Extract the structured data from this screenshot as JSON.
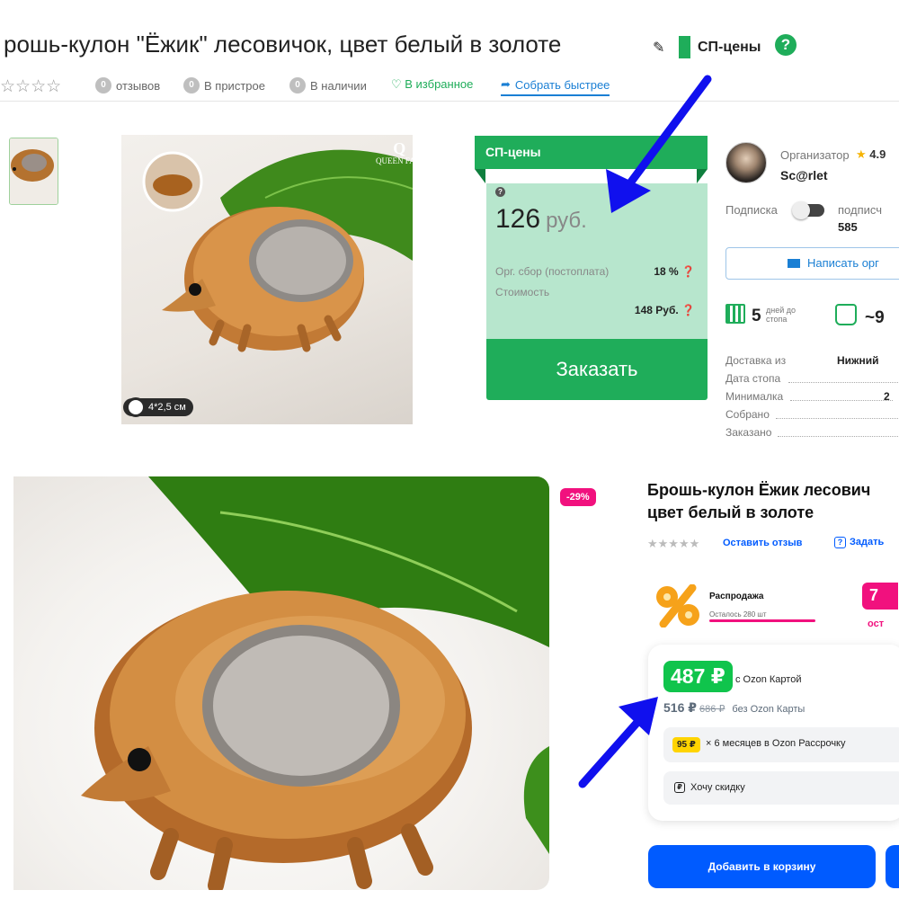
{
  "top": {
    "title": "рошь-кулон \"Ёжик\" лесовичок, цвет белый в золоте",
    "sp_label": "СП-цены",
    "stars": "☆☆☆☆",
    "meta": {
      "reviews_count": "0",
      "reviews_label": "отзывов",
      "fitting_count": "0",
      "fitting_label": "В пристрое",
      "stock_count": "0",
      "stock_label": "В наличии",
      "favorite_label": "♡ В избранное",
      "collect_label": "Собрать быстрее"
    },
    "size_tag": "4*2,5 см",
    "brand": {
      "mark": "Q",
      "name": "QUEEN FAIR"
    },
    "price_panel": {
      "header": "СП-цены",
      "price": "126",
      "unit": "руб.",
      "org_fee_label": "Орг. сбор (постоплата)",
      "org_fee_value": "18 %",
      "cost_label": "Стоимость",
      "cost_value": "148 Руб.",
      "order_button": "Заказать"
    },
    "organizer": {
      "label": "Организатор",
      "rating": "4.9",
      "name": "Sc@rlet",
      "subscription_label": "Подписка",
      "subscribers_label": "подписч",
      "subscribers_count": "585",
      "write_button": "Написать орг",
      "days_number": "5",
      "days_text_1": "дней до",
      "days_text_2": "стопа",
      "approx": "~9",
      "info": [
        {
          "label": "Доставка из",
          "value": "Нижний"
        },
        {
          "label": "Дата стопа",
          "value": ""
        },
        {
          "label": "Минималка",
          "value": "2"
        },
        {
          "label": "Собрано",
          "value": ""
        },
        {
          "label": "Заказано",
          "value": ""
        }
      ]
    }
  },
  "bottom": {
    "discount": "-29%",
    "title_line1": "Брошь-кулон Ёжик лесович",
    "title_line2": "цвет белый в золоте",
    "stars": "★★★★★",
    "review_link": "Оставить отзыв",
    "ask_link": "Задать",
    "sale_title": "Распродажа",
    "sale_left": "Осталось 280 шт",
    "promo_value": "7",
    "promo_sub": "ост",
    "card_price": "487 ₽",
    "card_label": "с Ozon Картой",
    "price_no_card": "516 ₽",
    "old_price": "686 ₽",
    "no_card_label": "без Ozon Карты",
    "installment_chip": "95 ₽",
    "installment_text": "× 6 месяцев в Ozon Рассрочку",
    "wish_text": "Хочу скидку",
    "cart_button": "Добавить в корзину"
  },
  "colors": {
    "sp_green": "#1fad5a",
    "panel_mint": "#b7e6cd",
    "ozon_blue": "#005bff",
    "ozon_pink": "#f1117e",
    "ozon_green": "#10c44c",
    "arrow_blue": "#1010ee"
  },
  "icons": [
    "wrench-icon",
    "help-icon",
    "heart-icon",
    "share-arrow-icon",
    "ruler-icon",
    "mail-icon",
    "calendar-icon",
    "bag-icon",
    "percent-icon",
    "question-icon",
    "discount-chat-icon"
  ]
}
